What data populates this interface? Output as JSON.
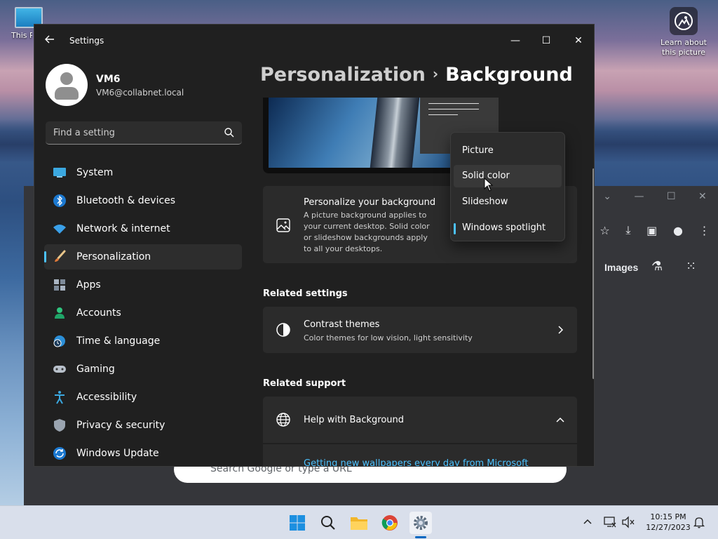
{
  "desktop": {
    "this_pc_label": "This PC",
    "learn_label": "Learn about this picture"
  },
  "chrome_window": {
    "images_link": "Images",
    "search_placeholder": "Search Google or type a URL"
  },
  "settings": {
    "app_title": "Settings",
    "user": {
      "name": "VM6",
      "email": "VM6@collabnet.local"
    },
    "search_placeholder": "Find a setting",
    "nav": [
      {
        "label": "System",
        "icon": "monitor-icon"
      },
      {
        "label": "Bluetooth & devices",
        "icon": "bluetooth-icon"
      },
      {
        "label": "Network & internet",
        "icon": "wifi-icon"
      },
      {
        "label": "Personalization",
        "icon": "brush-icon",
        "active": true
      },
      {
        "label": "Apps",
        "icon": "apps-icon"
      },
      {
        "label": "Accounts",
        "icon": "person-icon"
      },
      {
        "label": "Time & language",
        "icon": "globe-clock-icon"
      },
      {
        "label": "Gaming",
        "icon": "gamepad-icon"
      },
      {
        "label": "Accessibility",
        "icon": "accessibility-icon"
      },
      {
        "label": "Privacy & security",
        "icon": "shield-icon"
      },
      {
        "label": "Windows Update",
        "icon": "update-icon"
      }
    ],
    "breadcrumb": {
      "parent": "Personalization",
      "separator": "›",
      "current": "Background"
    },
    "personalize_card": {
      "title": "Personalize your background",
      "description": "A picture background applies to your current desktop. Solid color or slideshow backgrounds apply to all your desktops."
    },
    "dropdown": {
      "options": [
        "Picture",
        "Solid color",
        "Slideshow",
        "Windows spotlight"
      ],
      "selected": "Windows spotlight",
      "hovered": "Solid color"
    },
    "related_settings": {
      "heading": "Related settings",
      "contrast_title": "Contrast themes",
      "contrast_desc": "Color themes for low vision, light sensitivity"
    },
    "related_support": {
      "heading": "Related support",
      "help_title": "Help with Background",
      "help_link": "Getting new wallpapers every day from Microsoft"
    }
  },
  "taskbar": {
    "time": "10:15 PM",
    "date": "12/27/2023",
    "apps": [
      "start-icon",
      "search-icon",
      "file-explorer-icon",
      "chrome-icon",
      "settings-icon"
    ]
  },
  "colors": {
    "accent": "#4cc2ff",
    "window_bg": "#202020",
    "card_bg": "#2b2b2b",
    "taskbar_bg": "#d9dfeb"
  }
}
